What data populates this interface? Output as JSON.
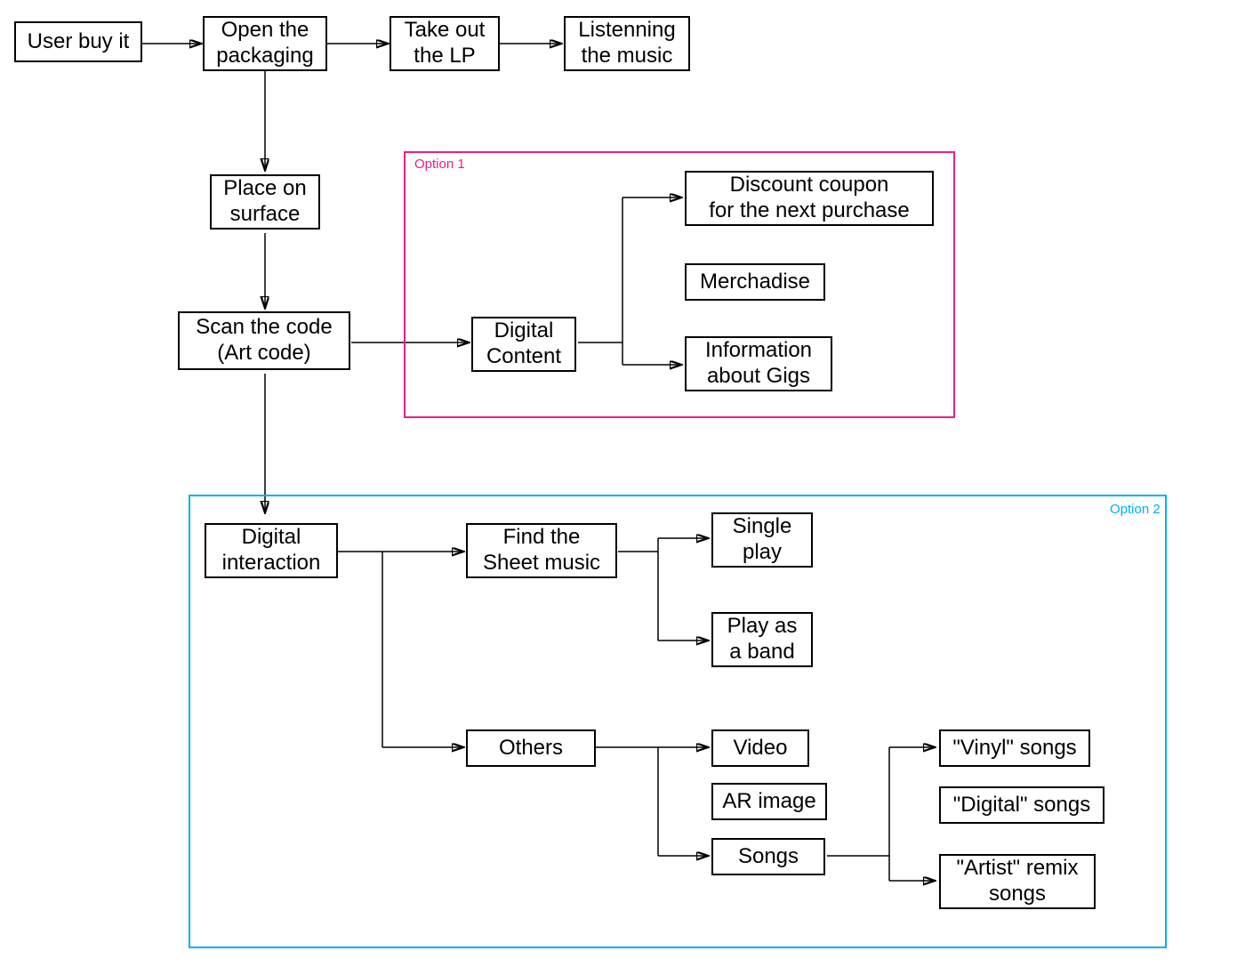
{
  "nodes": {
    "user_buy": "User buy it",
    "open_packaging": "Open the\npackaging",
    "take_out_lp": "Take out\nthe LP",
    "listening_music": "Listenning\nthe music",
    "place_surface": "Place on\nsurface",
    "scan_code": "Scan the code\n(Art code)",
    "digital_content": "Digital\nContent",
    "discount_coupon": "Discount coupon\nfor the next purchase",
    "merchandise": "Merchadise",
    "info_gigs": "Information\nabout Gigs",
    "digital_interaction": "Digital\ninteraction",
    "find_sheet": "Find the\nSheet music",
    "single_play": "Single\nplay",
    "play_band": "Play as\na band",
    "others": "Others",
    "video": "Video",
    "ar_image": "AR image",
    "songs": "Songs",
    "vinyl_songs": "\"Vinyl\" songs",
    "digital_songs": "\"Digital\" songs",
    "artist_remix": "\"Artist\" remix\nsongs"
  },
  "labels": {
    "option1": "Option 1",
    "option2": "Option 2"
  },
  "colors": {
    "option1": "#e91e8c",
    "option2": "#00b0f0"
  }
}
